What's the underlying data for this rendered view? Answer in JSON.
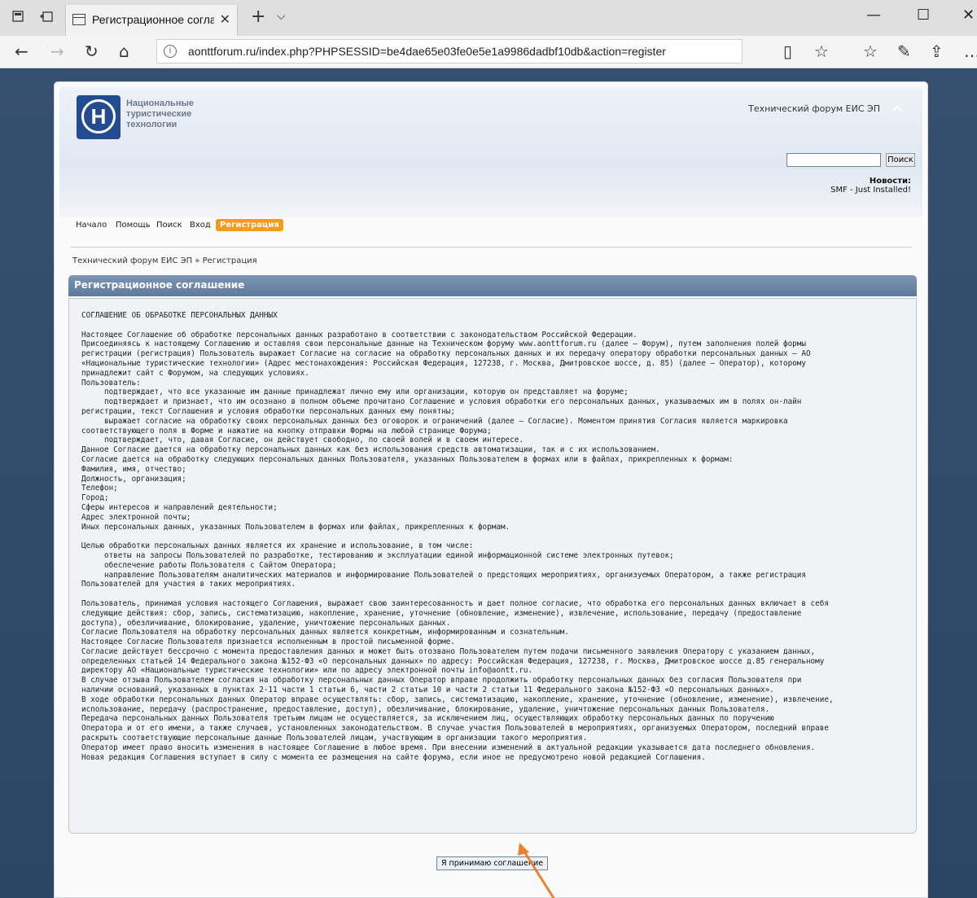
{
  "browser": {
    "tab_title": "Регистрационное согла:",
    "url": "aonttforum.ru/index.php?PHPSESSID=be4dae65e03fe0e5e1a9986dadbf10db&action=register"
  },
  "header": {
    "logo_text": "Национальные\nтуристические\nтехнологии",
    "forum_title": "Технический форум ЕИС ЭП",
    "search_button": "Поиск",
    "news_label": "Новости:",
    "news_text": "SMF - Just Installed!"
  },
  "menu": {
    "items": [
      "Начало",
      "Помощь",
      "Поиск",
      "Вход",
      "Регистрация"
    ],
    "active_color": "#f39b1a"
  },
  "breadcrumb": "Технический форум ЕИС ЭП » Регистрация",
  "section_title": "Регистрационное соглашение",
  "agreement_text": "СОГЛАШЕНИЕ ОБ ОБРАБОТКЕ ПЕРСОНАЛЬНЫХ ДАННЫХ\n\nНастоящее Соглашение об обработке персональных данных разработано в соответствии с законодательством Российской Федерации.\nПрисоединяясь к настоящему Соглашению и оставляя свои персональные данные на Техническом форуму www.aonttforum.ru (далее – Форум), путем заполнения полей формы\nрегистрации (регистрация) Пользователь выражает Согласие на согласие на обработку персональных данных и их передачу оператору обработки персональных данных – АО\n«Национальные туристические технологии» (Адрес местонахождения: Российская Федерация, 127238, г. Москва, Дмитровское шоссе, д. 85) (далее – Оператор), которому\nпринадлежит сайт с Форумом, на следующих условиях.\nПользователь:\n     подтверждает, что все указанные им данные принадлежат лично ему или организации, которую он представляет на форуме;\n     подтверждает и признает, что им осознано в полном объеме прочитано Соглашение и условия обработки его персональных данных, указываемых им в полях он-лайн\nрегистрации, текст Соглашения и условия обработки персональных данных ему понятны;\n     выражает согласие на обработку своих персональных данных без оговорок и ограничений (далее – Согласие). Моментом принятия Согласия является маркировка\nсоответствующего поля в Форме и нажатие на кнопку отправки Формы на любой странице Форума;\n     подтверждает, что, давая Согласие, он действует свободно, по своей волей и в своем интересе.\nДанное Согласие дается на обработку персональных данных как без использования средств автоматизации, так и с их использованием.\nСогласие дается на обработку следующих персональных данных Пользователя, указанных Пользователем в формах или в файлах, прикрепленных к формам:\nФамилия, имя, отчество;\nДолжность, организация;\nТелефон;\nГород;\nСферы интересов и направлений деятельности;\nАдрес электронной почты;\nИных персональных данных, указанных Пользователем в формах или файлах, прикрепленных к формам.\n\nЦелью обработки персональных данных является их хранение и использование, в том числе:\n     ответы на запросы Пользователей по разработке, тестированию и эксплуатации единой информационной системе электронных путевок;\n     обеспечение работы Пользователя с Сайтом Оператора;\n     направление Пользователям аналитических материалов и информирование Пользователей о предстоящих мероприятиях, организуемых Оператором, а также регистрация\nПользователей для участия в таких мероприятиях.\n\nПользователь, принимая условия настоящего Соглашения, выражает свою заинтересованность и дает полное согласие, что обработка его персональных данных включает в себя\nследующие действия: сбор, запись, систематизацию, накопление, хранение, уточнение (обновление, изменение), извлечение, использование, передачу (предоставление\nдоступа), обезличивание, блокирование, удаление, уничтожение персональных данных.\nСогласие Пользователя на обработку персональных данных является конкретным, информированным и сознательным.\nНастоящее Согласие Пользователя признается исполненным в простой письменной форме.\nСогласие действует бессрочно с момента предоставления данных и может быть отозвано Пользователем путем подачи письменного заявления Оператору с указанием данных,\nопределенных статьей 14 Федерального закона №152-ФЗ «О персональных данных» по адресу: Российская Федерация, 127238, г. Москва, Дмитровское шоссе д.85 генеральному\nдиректору АО «Национальные туристические технологии» или по адресу электронной почты info@aontt.ru.\nВ случае отзыва Пользователем согласия на обработку персональных данных Оператор вправе продолжить обработку персональных данных без согласия Пользователя при\nналичии оснований, указанных в пунктах 2-11 части 1 статьи 6, части 2 статьи 10 и части 2 статьи 11 Федерального закона №152-ФЗ «О персональных данных».\nВ ходе обработки персональных данных Оператор вправе осуществлять: сбор, запись, систематизацию, накопление, хранение, уточнение (обновление, изменение), извлечение,\nиспользование, передачу (распространение, предоставление, доступ), обезличивание, блокирование, удаление, уничтожение персональных данных Пользователя.\nПередача персональных данных Пользователя третьим лицам не осуществляется, за исключением лиц, осуществляющих обработку персональных данных по поручению\nОператора и от его имени, а также случаев, установленных законодательством. В случае участия Пользователей в мероприятиях, организуемых Оператором, последний вправе\nраскрыть соответствующие персональные данные Пользователей лицам, участвующим в организации такого мероприятия.\nОператор имеет право вносить изменения в настоящее Соглашение в любое время. При внесении изменений в актуальной редакции указывается дата последнего обновления.\nНовая редакция Соглашения вступает в силу с момента ее размещения на сайте форума, если иное не предусмотрено новой редакцией Соглашения.",
  "accept_button": "Я принимаю соглашение",
  "colors": {
    "page_bg": "#2e4a6b",
    "section_bar": "#6b86a8",
    "arrow": "#f07f2b"
  }
}
